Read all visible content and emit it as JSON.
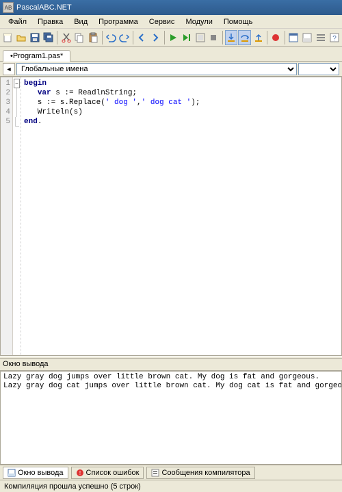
{
  "titlebar": {
    "title": "PascalABC.NET",
    "icon_label": "AB"
  },
  "menu": {
    "file": "Файл",
    "edit": "Правка",
    "view": "Вид",
    "program": "Программа",
    "service": "Сервис",
    "modules": "Модули",
    "help": "Помощь"
  },
  "tabs": {
    "active": "•Program1.pas*"
  },
  "navbar": {
    "scope_label": "Глобальные имена"
  },
  "code": {
    "lines": [
      "1",
      "2",
      "3",
      "4",
      "5"
    ],
    "l1_kw": "begin",
    "l2_indent": "   ",
    "l2_kw": "var",
    "l2_rest": " s := ReadlnString;",
    "l3_indent": "   s := s.Replace(",
    "l3_s1": "' dog '",
    "l3_mid": ",",
    "l3_s2": "' dog cat '",
    "l3_end": ");",
    "l4": "   Writeln(s)",
    "l5_kw": "end",
    "l5_end": "."
  },
  "output": {
    "title": "Окно вывода",
    "line1": "Lazy gray dog jumps over little brown cat. My dog is fat and gorgeous.",
    "line2": "Lazy gray dog cat jumps over little brown cat. My dog cat is fat and gorgeous."
  },
  "bottom_tabs": {
    "output": "Окно вывода",
    "errors": "Список ошибок",
    "compiler": "Сообщения компилятора"
  },
  "status": {
    "text": "Компиляция прошла успешно (5 строк)"
  }
}
